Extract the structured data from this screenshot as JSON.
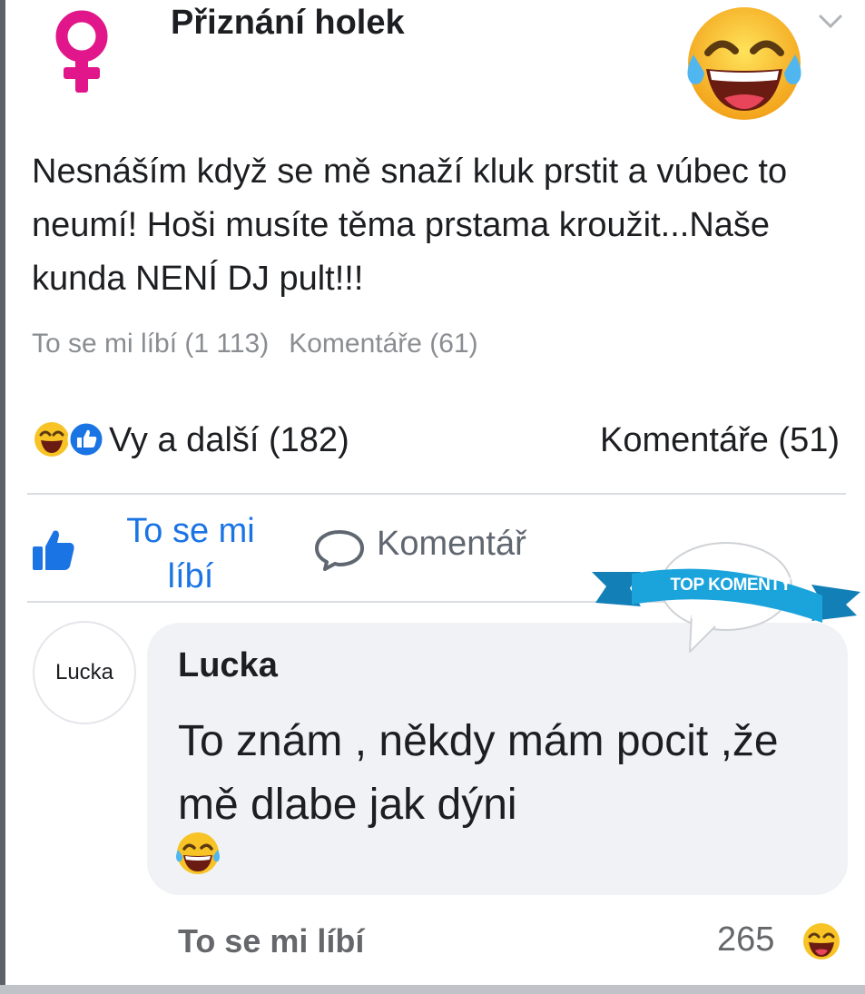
{
  "header": {
    "group_name": "Přiznání holek",
    "group_icon": "venus-symbol-icon",
    "decoration_icon": "laughing-tears-emoji-icon",
    "menu_icon": "chevron-down-icon"
  },
  "post": {
    "text": "Nesnáším když se mě snaží kluk prstit a vúbec to neumí! Hoši musíte těma prstama kroužit...Naše kunda NENÍ DJ pult!!!",
    "original_likes": "To se mi líbí (1 113)",
    "original_comments": "Komentáře (61)"
  },
  "reactions": {
    "icons": [
      "laughing-emoji-icon",
      "thumbs-up-icon"
    ],
    "summary": "Vy a další (182)",
    "comments": "Komentáře (51)"
  },
  "actions": {
    "like_label": "To se mi líbí",
    "comment_label": "Komentář"
  },
  "badge": {
    "text": "TOP KOMENTY"
  },
  "comment": {
    "avatar_text": "Lucka",
    "author": "Lucka",
    "text": "To znám , někdy mám pocit ,že mě dlabe jak dýni",
    "like_label": "To se mi líbí",
    "reaction_count": "265"
  },
  "colors": {
    "brand_blue": "#1b74e4",
    "badge_blue": "#1ba3dc",
    "venus_pink": "#e0168a",
    "emoji_yellow": "#f7c325"
  }
}
